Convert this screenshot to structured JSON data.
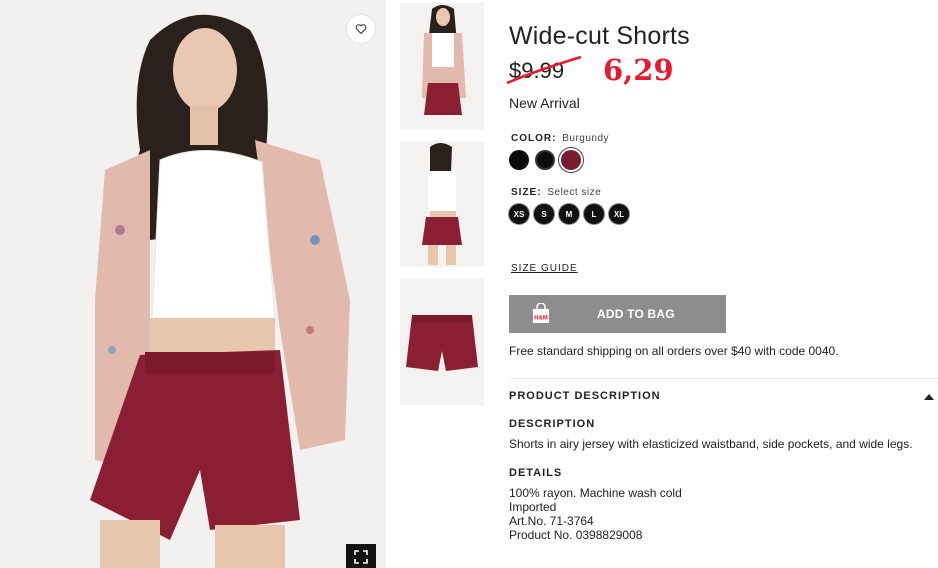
{
  "product": {
    "title": "Wide-cut Shorts",
    "old_price": "$9.99",
    "new_price": "6,29",
    "badge": "New Arrival"
  },
  "color": {
    "label": "COLOR:",
    "selected": "Burgundy",
    "swatches": [
      "#0b0b0b",
      "#0b0b0b",
      "#7a1c2b"
    ]
  },
  "size": {
    "label": "SIZE:",
    "selected": "Select size",
    "options": [
      "XS",
      "S",
      "M",
      "L",
      "XL"
    ]
  },
  "size_guide": "SIZE GUIDE",
  "add_to_bag": {
    "label": "ADD TO BAG",
    "icon": "shopping-bag-icon",
    "icon_text": "H&M"
  },
  "shipping_note": "Free standard shipping on all orders over $40 with code 0040.",
  "product_description": {
    "header": "PRODUCT DESCRIPTION",
    "description_heading": "DESCRIPTION",
    "description_text": "Shorts in airy jersey with elasticized waistband, side pockets, and wide legs.",
    "details_heading": "DETAILS",
    "details": [
      "100% rayon. Machine wash cold",
      "Imported",
      "Art.No. 71-3764",
      "Product No. 0398829008"
    ]
  },
  "colors": {
    "price_annotation": "#e8192c",
    "burgundy": "#7a1c2b",
    "button_bg": "#8d8d8d"
  }
}
